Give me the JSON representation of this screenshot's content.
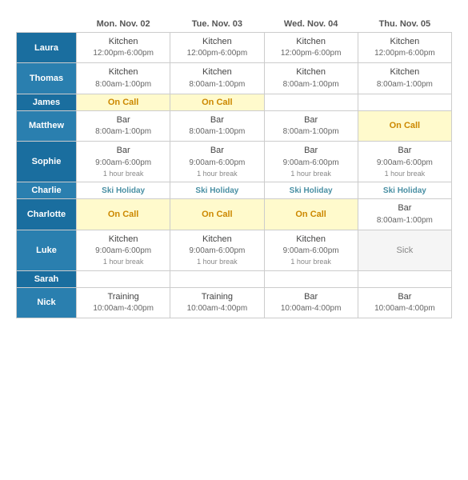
{
  "headers": [
    "",
    "Mon. Nov. 02",
    "Tue. Nov. 03",
    "Wed. Nov. 04",
    "Thu. Nov. 05"
  ],
  "rows": [
    {
      "name": "Laura",
      "cells": [
        {
          "type": "regular",
          "main": "Kitchen",
          "time": "12:00pm-6:00pm",
          "note": ""
        },
        {
          "type": "regular",
          "main": "Kitchen",
          "time": "12:00pm-6:00pm",
          "note": ""
        },
        {
          "type": "regular",
          "main": "Kitchen",
          "time": "12:00pm-6:00pm",
          "note": ""
        },
        {
          "type": "regular",
          "main": "Kitchen",
          "time": "12:00pm-6:00pm",
          "note": ""
        }
      ]
    },
    {
      "name": "Thomas",
      "cells": [
        {
          "type": "regular",
          "main": "Kitchen",
          "time": "8:00am-1:00pm",
          "note": ""
        },
        {
          "type": "regular",
          "main": "Kitchen",
          "time": "8:00am-1:00pm",
          "note": ""
        },
        {
          "type": "regular",
          "main": "Kitchen",
          "time": "8:00am-1:00pm",
          "note": ""
        },
        {
          "type": "regular",
          "main": "Kitchen",
          "time": "8:00am-1:00pm",
          "note": ""
        }
      ]
    },
    {
      "name": "James",
      "cells": [
        {
          "type": "oncall",
          "main": "On Call",
          "time": "",
          "note": ""
        },
        {
          "type": "oncall",
          "main": "On Call",
          "time": "",
          "note": ""
        },
        {
          "type": "empty",
          "main": "",
          "time": "",
          "note": ""
        },
        {
          "type": "empty",
          "main": "",
          "time": "",
          "note": ""
        }
      ]
    },
    {
      "name": "Matthew",
      "cells": [
        {
          "type": "regular",
          "main": "Bar",
          "time": "8:00am-1:00pm",
          "note": ""
        },
        {
          "type": "regular",
          "main": "Bar",
          "time": "8:00am-1:00pm",
          "note": ""
        },
        {
          "type": "regular",
          "main": "Bar",
          "time": "8:00am-1:00pm",
          "note": ""
        },
        {
          "type": "oncall",
          "main": "On Call",
          "time": "",
          "note": ""
        }
      ]
    },
    {
      "name": "Sophie",
      "cells": [
        {
          "type": "regular",
          "main": "Bar",
          "time": "9:00am-6:00pm",
          "note": "1 hour break"
        },
        {
          "type": "regular",
          "main": "Bar",
          "time": "9:00am-6:00pm",
          "note": "1 hour break"
        },
        {
          "type": "regular",
          "main": "Bar",
          "time": "9:00am-6:00pm",
          "note": "1 hour break"
        },
        {
          "type": "regular",
          "main": "Bar",
          "time": "9:00am-6:00pm",
          "note": "1 hour break"
        }
      ]
    },
    {
      "name": "Charlie",
      "cells": [
        {
          "type": "holiday",
          "main": "Ski Holiday",
          "time": "",
          "note": ""
        },
        {
          "type": "holiday",
          "main": "Ski Holiday",
          "time": "",
          "note": ""
        },
        {
          "type": "holiday",
          "main": "Ski Holiday",
          "time": "",
          "note": ""
        },
        {
          "type": "holiday",
          "main": "Ski Holiday",
          "time": "",
          "note": ""
        }
      ]
    },
    {
      "name": "Charlotte",
      "cells": [
        {
          "type": "oncall",
          "main": "On Call",
          "time": "",
          "note": ""
        },
        {
          "type": "oncall",
          "main": "On Call",
          "time": "",
          "note": ""
        },
        {
          "type": "oncall",
          "main": "On Call",
          "time": "",
          "note": ""
        },
        {
          "type": "regular",
          "main": "Bar",
          "time": "8:00am-1:00pm",
          "note": ""
        }
      ]
    },
    {
      "name": "Luke",
      "cells": [
        {
          "type": "regular",
          "main": "Kitchen",
          "time": "9:00am-6:00pm",
          "note": "1 hour break"
        },
        {
          "type": "regular",
          "main": "Kitchen",
          "time": "9:00am-6:00pm",
          "note": "1 hour break"
        },
        {
          "type": "regular",
          "main": "Kitchen",
          "time": "9:00am-6:00pm",
          "note": "1 hour break"
        },
        {
          "type": "sick",
          "main": "Sick",
          "time": "",
          "note": ""
        }
      ]
    },
    {
      "name": "Sarah",
      "cells": [
        {
          "type": "empty",
          "main": "",
          "time": "",
          "note": ""
        },
        {
          "type": "empty",
          "main": "",
          "time": "",
          "note": ""
        },
        {
          "type": "empty",
          "main": "",
          "time": "",
          "note": ""
        },
        {
          "type": "empty",
          "main": "",
          "time": "",
          "note": ""
        }
      ]
    },
    {
      "name": "Nick",
      "cells": [
        {
          "type": "regular",
          "main": "Training",
          "time": "10:00am-4:00pm",
          "note": ""
        },
        {
          "type": "regular",
          "main": "Training",
          "time": "10:00am-4:00pm",
          "note": ""
        },
        {
          "type": "regular",
          "main": "Bar",
          "time": "10:00am-4:00pm",
          "note": ""
        },
        {
          "type": "regular",
          "main": "Bar",
          "time": "10:00am-4:00pm",
          "note": ""
        }
      ]
    }
  ]
}
